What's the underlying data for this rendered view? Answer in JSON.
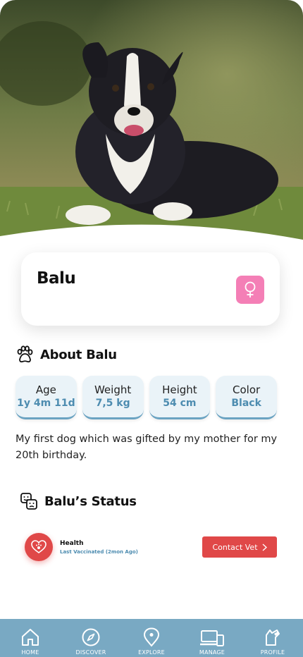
{
  "pet": {
    "name": "Balu",
    "gender_icon": "female-icon",
    "gender_color": "#f47fb6"
  },
  "about": {
    "title": "About Balu",
    "icon": "paw-icon",
    "stats": [
      {
        "label": "Age",
        "value": "1y 4m 11d"
      },
      {
        "label": "Weight",
        "value": "7,5 kg"
      },
      {
        "label": "Height",
        "value": "54 cm"
      },
      {
        "label": "Color",
        "value": "Black"
      }
    ],
    "description": "My first dog which was gifted by my mother for my 20th birthday."
  },
  "status": {
    "title": "Balu’s Status",
    "icon": "status-faces-icon",
    "health": {
      "title": "Health",
      "subtitle": "Last Vaccinated (2mon Ago)",
      "icon": "heart-paw-icon",
      "button_label": "Contact Vet"
    }
  },
  "nav": {
    "items": [
      {
        "label": "HOME",
        "icon": "home-icon"
      },
      {
        "label": "DISCOVER",
        "icon": "compass-icon"
      },
      {
        "label": "EXPLORE",
        "icon": "location-pin-icon"
      },
      {
        "label": "MANAGE",
        "icon": "devices-icon"
      },
      {
        "label": "PROFILE",
        "icon": "pet-profile-icon"
      }
    ]
  },
  "colors": {
    "accent_blue": "#79a9c3",
    "value_blue": "#4d8cb0",
    "danger_red": "#e04848",
    "pink": "#f47fb6"
  }
}
